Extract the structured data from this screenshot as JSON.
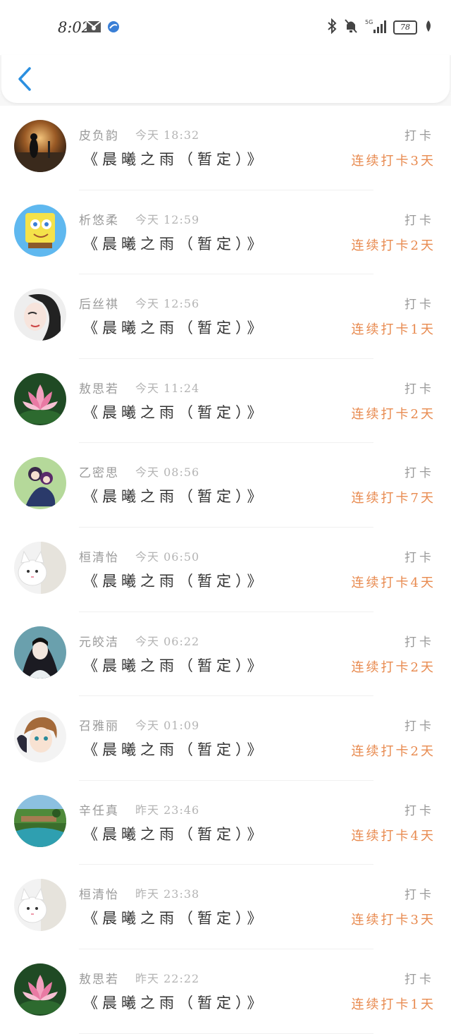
{
  "status_bar": {
    "time": "8:02",
    "battery": "78",
    "icons": [
      "mail-icon",
      "browser-icon",
      "bluetooth-icon",
      "mute-bell-icon",
      "signal-5g-icon",
      "battery-icon",
      "leaf-icon"
    ]
  },
  "nav": {
    "back_icon": "chevron-left-icon"
  },
  "colors": {
    "accent_blue": "#2b8fe0",
    "streak_orange": "#e88a4f"
  },
  "records": [
    {
      "name": "皮负韵",
      "time": "今天 18:32",
      "book": "《晨曦之雨（暂定）》",
      "action": "打卡",
      "streak": "连续打卡3天",
      "avatar": "silhouette-sunset"
    },
    {
      "name": "析悠柔",
      "time": "今天 12:59",
      "book": "《晨曦之雨（暂定）》",
      "action": "打卡",
      "streak": "连续打卡2天",
      "avatar": "cartoon-sponge"
    },
    {
      "name": "后丝祺",
      "time": "今天 12:56",
      "book": "《晨曦之雨（暂定）》",
      "action": "打卡",
      "streak": "连续打卡1天",
      "avatar": "girl-portrait"
    },
    {
      "name": "敖思若",
      "time": "今天 11:24",
      "book": "《晨曦之雨（暂定）》",
      "action": "打卡",
      "streak": "连续打卡2天",
      "avatar": "lotus-flower"
    },
    {
      "name": "乙密思",
      "time": "今天 08:56",
      "book": "《晨曦之雨（暂定）》",
      "action": "打卡",
      "streak": "连续打卡7天",
      "avatar": "anime-couple"
    },
    {
      "name": "桓清怡",
      "time": "今天 06:50",
      "book": "《晨曦之雨（暂定）》",
      "action": "打卡",
      "streak": "连续打卡4天",
      "avatar": "white-cat"
    },
    {
      "name": "元皎洁",
      "time": "今天 06:22",
      "book": "《晨曦之雨（暂定）》",
      "action": "打卡",
      "streak": "连续打卡2天",
      "avatar": "anime-swordsman"
    },
    {
      "name": "召雅丽",
      "time": "今天 01:09",
      "book": "《晨曦之雨（暂定）》",
      "action": "打卡",
      "streak": "连续打卡2天",
      "avatar": "anime-boy"
    },
    {
      "name": "辛任真",
      "time": "昨天 23:46",
      "book": "《晨曦之雨（暂定）》",
      "action": "打卡",
      "streak": "连续打卡4天",
      "avatar": "garden-landscape"
    },
    {
      "name": "桓清怡",
      "time": "昨天 23:38",
      "book": "《晨曦之雨（暂定）》",
      "action": "打卡",
      "streak": "连续打卡3天",
      "avatar": "white-cat"
    },
    {
      "name": "敖思若",
      "time": "昨天 22:22",
      "book": "《晨曦之雨（暂定）》",
      "action": "打卡",
      "streak": "连续打卡1天",
      "avatar": "lotus-flower"
    }
  ]
}
